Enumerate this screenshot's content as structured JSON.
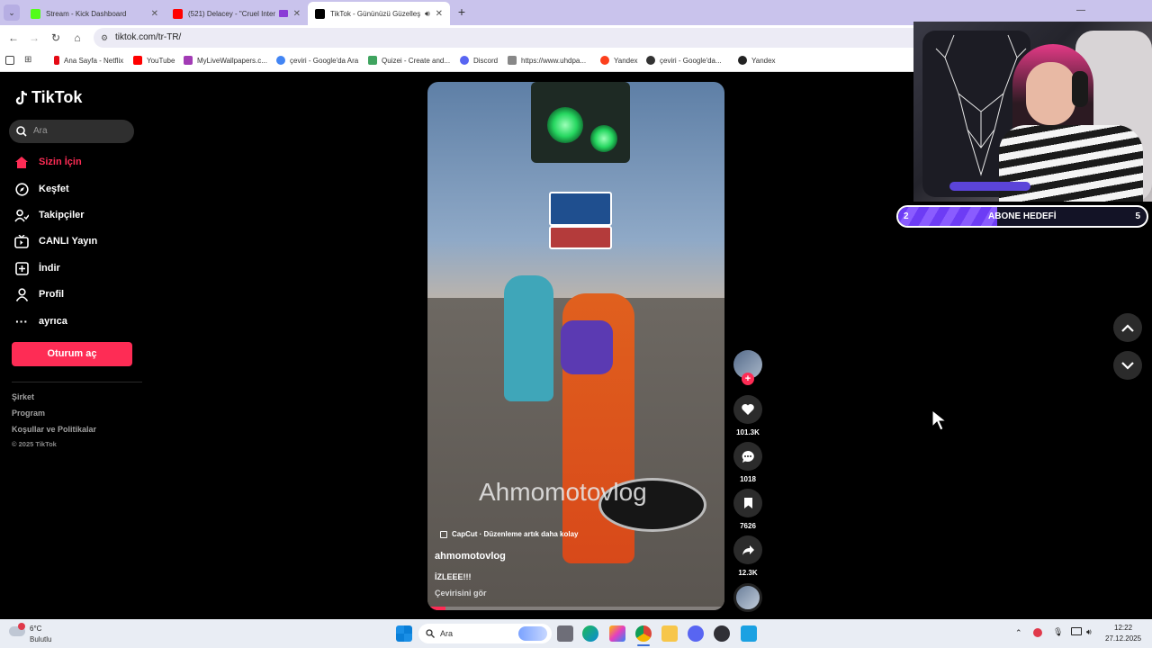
{
  "browser": {
    "tabs": [
      {
        "title": "Stream - Kick Dashboard",
        "favicon_color": "#53fc18"
      },
      {
        "title": "(521) Delacey - \"Cruel Inten",
        "favicon_color": "#ff0000"
      },
      {
        "title": "TikTok - Gününüzü Güzelleş",
        "favicon_color": "#000000"
      }
    ],
    "url": "tiktok.com/tr-TR/",
    "bookmarks": [
      "Ana Sayfa - Netflix",
      "YouTube",
      "MyLiveWallpapers.c...",
      "çeviri - Google'da Ara",
      "Quizei - Create and...",
      "Discord",
      "https://www.uhdpa...",
      "Yandex",
      "çeviri - Google'da...",
      "Yandex"
    ]
  },
  "sidebar": {
    "logo": "TikTok",
    "search_placeholder": "Ara",
    "nav": [
      {
        "label": "Sizin İçin",
        "icon": "home-icon"
      },
      {
        "label": "Keşfet",
        "icon": "compass-icon"
      },
      {
        "label": "Takipçiler",
        "icon": "following-icon"
      },
      {
        "label": "CANLI Yayın",
        "icon": "live-icon"
      },
      {
        "label": "İndir",
        "icon": "download-icon"
      },
      {
        "label": "Profil",
        "icon": "profile-icon"
      },
      {
        "label": "ayrıca",
        "icon": "more-icon"
      }
    ],
    "login_button": "Oturum aç",
    "footer": [
      "Şirket",
      "Program",
      "Koşullar ve Politikalar"
    ],
    "copyright": "© 2025 TikTok"
  },
  "video": {
    "watermark": "Ahmomotovlog",
    "capcut": "CapCut · Düzenleme artık daha kolay",
    "author": "ahmomotovlog",
    "description": "İZLEEE!!!",
    "translate": "Çevirisini gör"
  },
  "actions": {
    "likes": "101.3K",
    "comments": "1018",
    "saves": "7626",
    "shares": "12.3K"
  },
  "overlay": {
    "goal_label": "ABONE HEDEFİ",
    "goal_current": "2",
    "goal_target": "5",
    "goal_fraction": 0.4
  },
  "taskbar": {
    "weather_temp": "6°C",
    "weather_desc": "Bulutlu",
    "search_placeholder": "Ara",
    "time": "12:22",
    "date": "27.12.2025"
  },
  "colors": {
    "accent": "#fe2c55",
    "goal": "#7b4cff",
    "tabbar": "#c9c3ec"
  }
}
